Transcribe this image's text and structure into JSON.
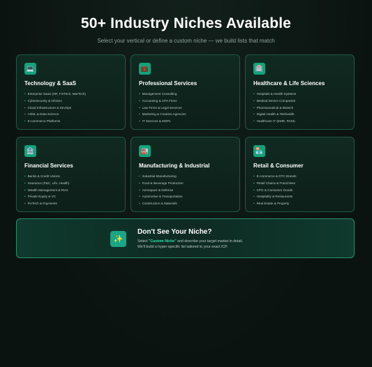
{
  "header": {
    "title": "50+ Industry Niches Available",
    "subtitle": "Select your vertical or define a custom niche — we build lists that match"
  },
  "colors": {
    "background": "#0d1512",
    "accent": "#2fd39e",
    "icon_bg": "#12a37a",
    "card_border": "#1f5a45"
  },
  "cards": [
    {
      "icon": "laptop-icon",
      "icon_glyph": "💻",
      "title": "Technology & SaaS",
      "items": [
        "Enterprise SaaS (HR, FinTech, MarTech)",
        "Cybersecurity & InfoSec",
        "Cloud Infrastructure & DevOps",
        "AI/ML & Data Science",
        "E-commerce Platforms"
      ]
    },
    {
      "icon": "briefcase-icon",
      "icon_glyph": "💼",
      "title": "Professional Services",
      "items": [
        "Management Consulting",
        "Accounting & CPA Firms",
        "Law Firms & Legal Services",
        "Marketing & Creative Agencies",
        "IT Services & MSPs"
      ]
    },
    {
      "icon": "hospital-icon",
      "icon_glyph": "🏥",
      "title": "Healthcare & Life Sciences",
      "items": [
        "Hospitals & Health Systems",
        "Medical Device Companies",
        "Pharmaceutical & Biotech",
        "Digital Health & Telehealth",
        "Healthcare IT (EMR, RCM)"
      ]
    },
    {
      "icon": "bank-icon",
      "icon_glyph": "🏦",
      "title": "Financial Services",
      "items": [
        "Banks & Credit Unions",
        "Insurance (P&C, Life, Health)",
        "Wealth Management & RIAs",
        "Private Equity & VC",
        "FinTech & Payments"
      ]
    },
    {
      "icon": "factory-icon",
      "icon_glyph": "🏭",
      "title": "Manufacturing & Industrial",
      "items": [
        "Industrial Manufacturing",
        "Food & Beverage Production",
        "Aerospace & Defense",
        "Automotive & Transportation",
        "Construction & Materials"
      ]
    },
    {
      "icon": "storefront-icon",
      "icon_glyph": "🏪",
      "title": "Retail & Consumer",
      "items": [
        "E-commerce & DTC Brands",
        "Retail Chains & Franchises",
        "CPG & Consumer Goods",
        "Hospitality & Restaurants",
        "Real Estate & Property"
      ]
    }
  ],
  "custom": {
    "icon": "sparkles-icon",
    "icon_glyph": "✨",
    "title": "Don't See Your Niche?",
    "line1_prefix": "Select ",
    "line1_highlight": "\"Custom Niche\"",
    "line1_suffix": " and describe your target market in detail.",
    "line2": "We'll build a hyper-specific list tailored to your exact ICP."
  }
}
